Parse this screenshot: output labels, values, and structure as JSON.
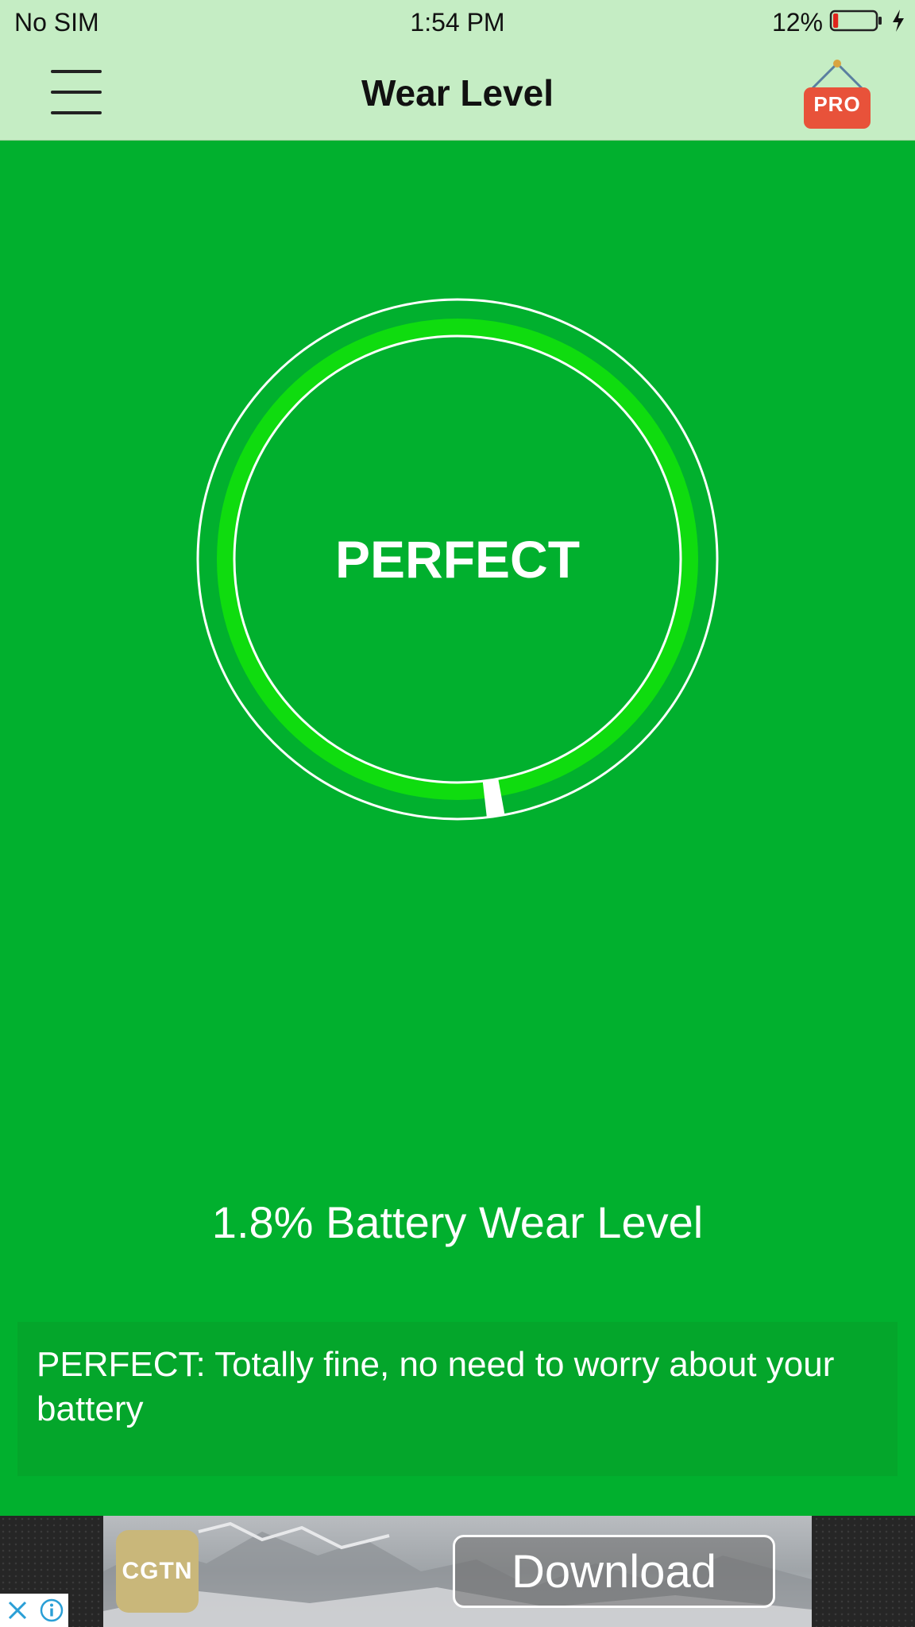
{
  "status_bar": {
    "carrier": "No SIM",
    "time": "1:54 PM",
    "battery_percent": "12%",
    "battery_level": 0.12,
    "icons": [
      "battery-icon",
      "charging-bolt-icon"
    ]
  },
  "nav": {
    "title": "Wear Level",
    "menu_icon": "hamburger-menu-icon",
    "pro_label": "PRO"
  },
  "gauge": {
    "label": "PERFECT",
    "wear_fraction": 0.018,
    "ring_color": "#0fdc0f",
    "marker_color": "#ffffff"
  },
  "wear": {
    "value": "1.8%",
    "label": "Battery Wear Level"
  },
  "info": {
    "text": "PERFECT: Totally fine, no need to worry about your battery"
  },
  "ad": {
    "brand": "CGTN",
    "cta": "Download",
    "icons": [
      "close-icon",
      "info-icon"
    ]
  },
  "colors": {
    "background": "#01b02e",
    "bars": "#c5edc4",
    "pro_badge": "#e8523a"
  }
}
